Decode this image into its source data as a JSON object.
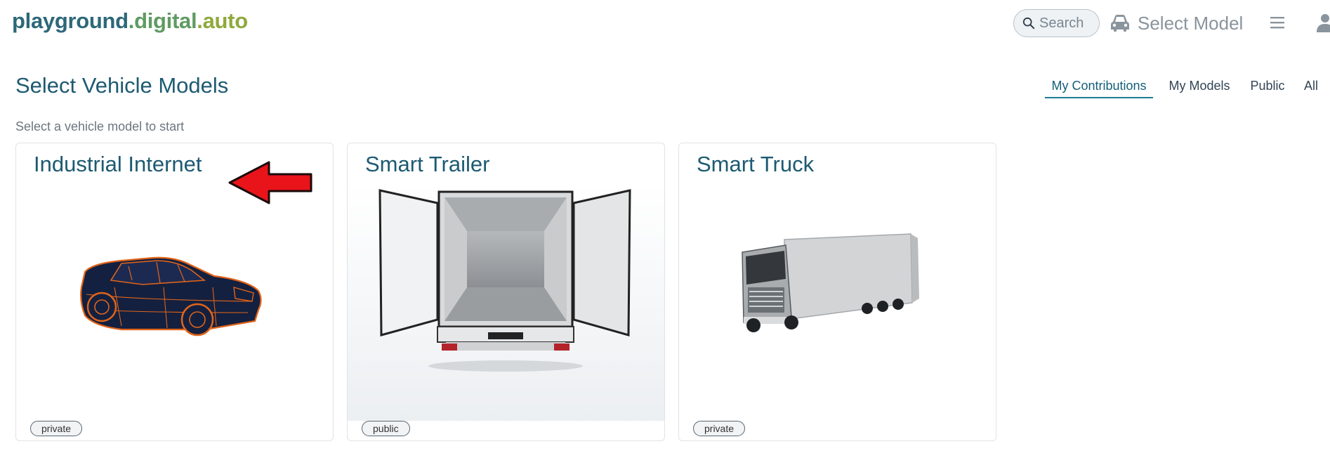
{
  "header": {
    "logo": {
      "part1": "playground",
      "part2": ".digital",
      "part3": ".auto"
    },
    "search": {
      "placeholder": "Search",
      "icon": "search-icon"
    },
    "select_model": {
      "label": "Select Model",
      "icon": "car-icon"
    },
    "menu_icon": "hamburger-menu-icon",
    "user_icon": "user-icon"
  },
  "page": {
    "title": "Select Vehicle Models",
    "subtitle": "Select a vehicle model to start"
  },
  "tabs": [
    {
      "label": "My Contributions",
      "active": true
    },
    {
      "label": "My Models",
      "active": false
    },
    {
      "label": "Public",
      "active": false
    },
    {
      "label": "All",
      "active": false
    }
  ],
  "cards": [
    {
      "title": "Industrial Internet",
      "visibility": "private",
      "image": "wireframe-car-image"
    },
    {
      "title": "Smart Trailer",
      "visibility": "public",
      "image": "open-trailer-image"
    },
    {
      "title": "Smart Truck",
      "visibility": "private",
      "image": "semi-truck-image"
    }
  ],
  "colors": {
    "title": "#1d5a72",
    "logo_part1": "#2d6878",
    "logo_part2": "#5f9b62",
    "logo_part3": "#8fa93d",
    "tab_active_underline": "#1f7a92",
    "annotation_arrow": "#e8141a"
  }
}
